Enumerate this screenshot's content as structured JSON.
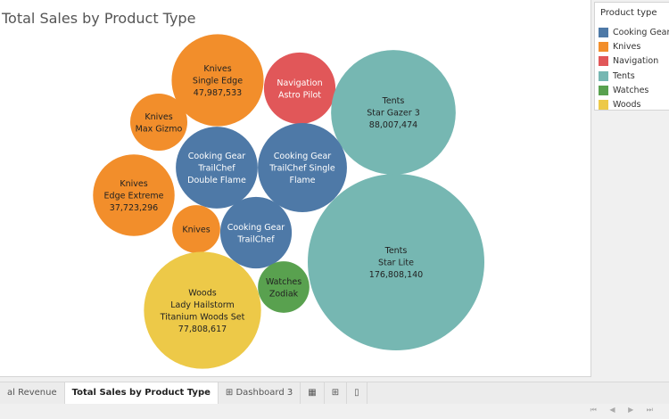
{
  "colors": {
    "Cooking Gear": "#4e79a7",
    "Knives": "#f28e2b",
    "Navigation": "#e15759",
    "Tents": "#76b7b2",
    "Watches": "#59a14f",
    "Woods": "#edc948"
  },
  "chart_data": {
    "type": "bubble",
    "title": "Total Sales by Product Type",
    "legend_title": "Product type",
    "legend": [
      "Cooking Gear",
      "Knives",
      "Navigation",
      "Tents",
      "Watches",
      "Woods"
    ],
    "legend_position": "top-right",
    "bubbles": [
      {
        "type": "Knives",
        "product": "Single Edge",
        "value": 47987533,
        "label": [
          "Knives",
          "Single Edge",
          "47,987,533"
        ]
      },
      {
        "type": "Navigation",
        "product": "Astro Pilot",
        "value": 29000000,
        "label": [
          "Navigation",
          "Astro Pilot"
        ]
      },
      {
        "type": "Tents",
        "product": "Star Gazer 3",
        "value": 88007474,
        "label": [
          "Tents",
          "Star Gazer 3",
          "88,007,474"
        ]
      },
      {
        "type": "Knives",
        "product": "Max Gizmo",
        "value": 18500000,
        "label": [
          "Knives",
          "Max Gizmo"
        ]
      },
      {
        "type": "Cooking Gear",
        "product": "TrailChef Double Flame",
        "value": 38000000,
        "label": [
          "Cooking Gear",
          "TrailChef",
          "Double Flame"
        ]
      },
      {
        "type": "Cooking Gear",
        "product": "TrailChef Single Flame",
        "value": 45000000,
        "label": [
          "Cooking Gear",
          "TrailChef Single",
          "Flame"
        ]
      },
      {
        "type": "Knives",
        "product": "Edge Extreme",
        "value": 37723296,
        "label": [
          "Knives",
          "Edge Extreme",
          "37,723,296"
        ]
      },
      {
        "type": "Knives",
        "product": "",
        "value": 13000000,
        "label": [
          "Knives"
        ]
      },
      {
        "type": "Cooking Gear",
        "product": "TrailChef",
        "value": 29000000,
        "label": [
          "Cooking Gear",
          "TrailChef"
        ]
      },
      {
        "type": "Tents",
        "product": "Star Lite",
        "value": 176808140,
        "label": [
          "Tents",
          "Star Lite",
          "176,808,140"
        ]
      },
      {
        "type": "Watches",
        "product": "Zodiak",
        "value": 15000000,
        "label": [
          "Watches",
          "Zodiak"
        ]
      },
      {
        "type": "Woods",
        "product": "Lady Hailstorm Titanium Woods Set",
        "value": 77808617,
        "label": [
          "Woods",
          "Lady Hailstorm",
          "Titanium Woods Set",
          "77,808,617"
        ]
      }
    ]
  },
  "tabs": [
    "al Revenue",
    "Total Sales by Product Type",
    "Dashboard 3"
  ],
  "nav": "⏮ ◀ ▶ ⏭"
}
